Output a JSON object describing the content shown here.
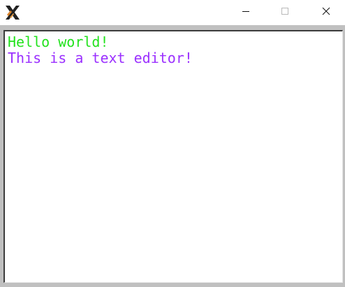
{
  "window": {
    "app_icon": "x-logo-icon",
    "controls": {
      "minimize_icon": "minimize-icon",
      "maximize_icon": "maximize-icon",
      "close_icon": "close-icon"
    }
  },
  "editor": {
    "lines": [
      {
        "text": "Hello world!",
        "color": "#22e21d"
      },
      {
        "text": "This is a text editor!",
        "color": "#9b30ff"
      }
    ]
  }
}
